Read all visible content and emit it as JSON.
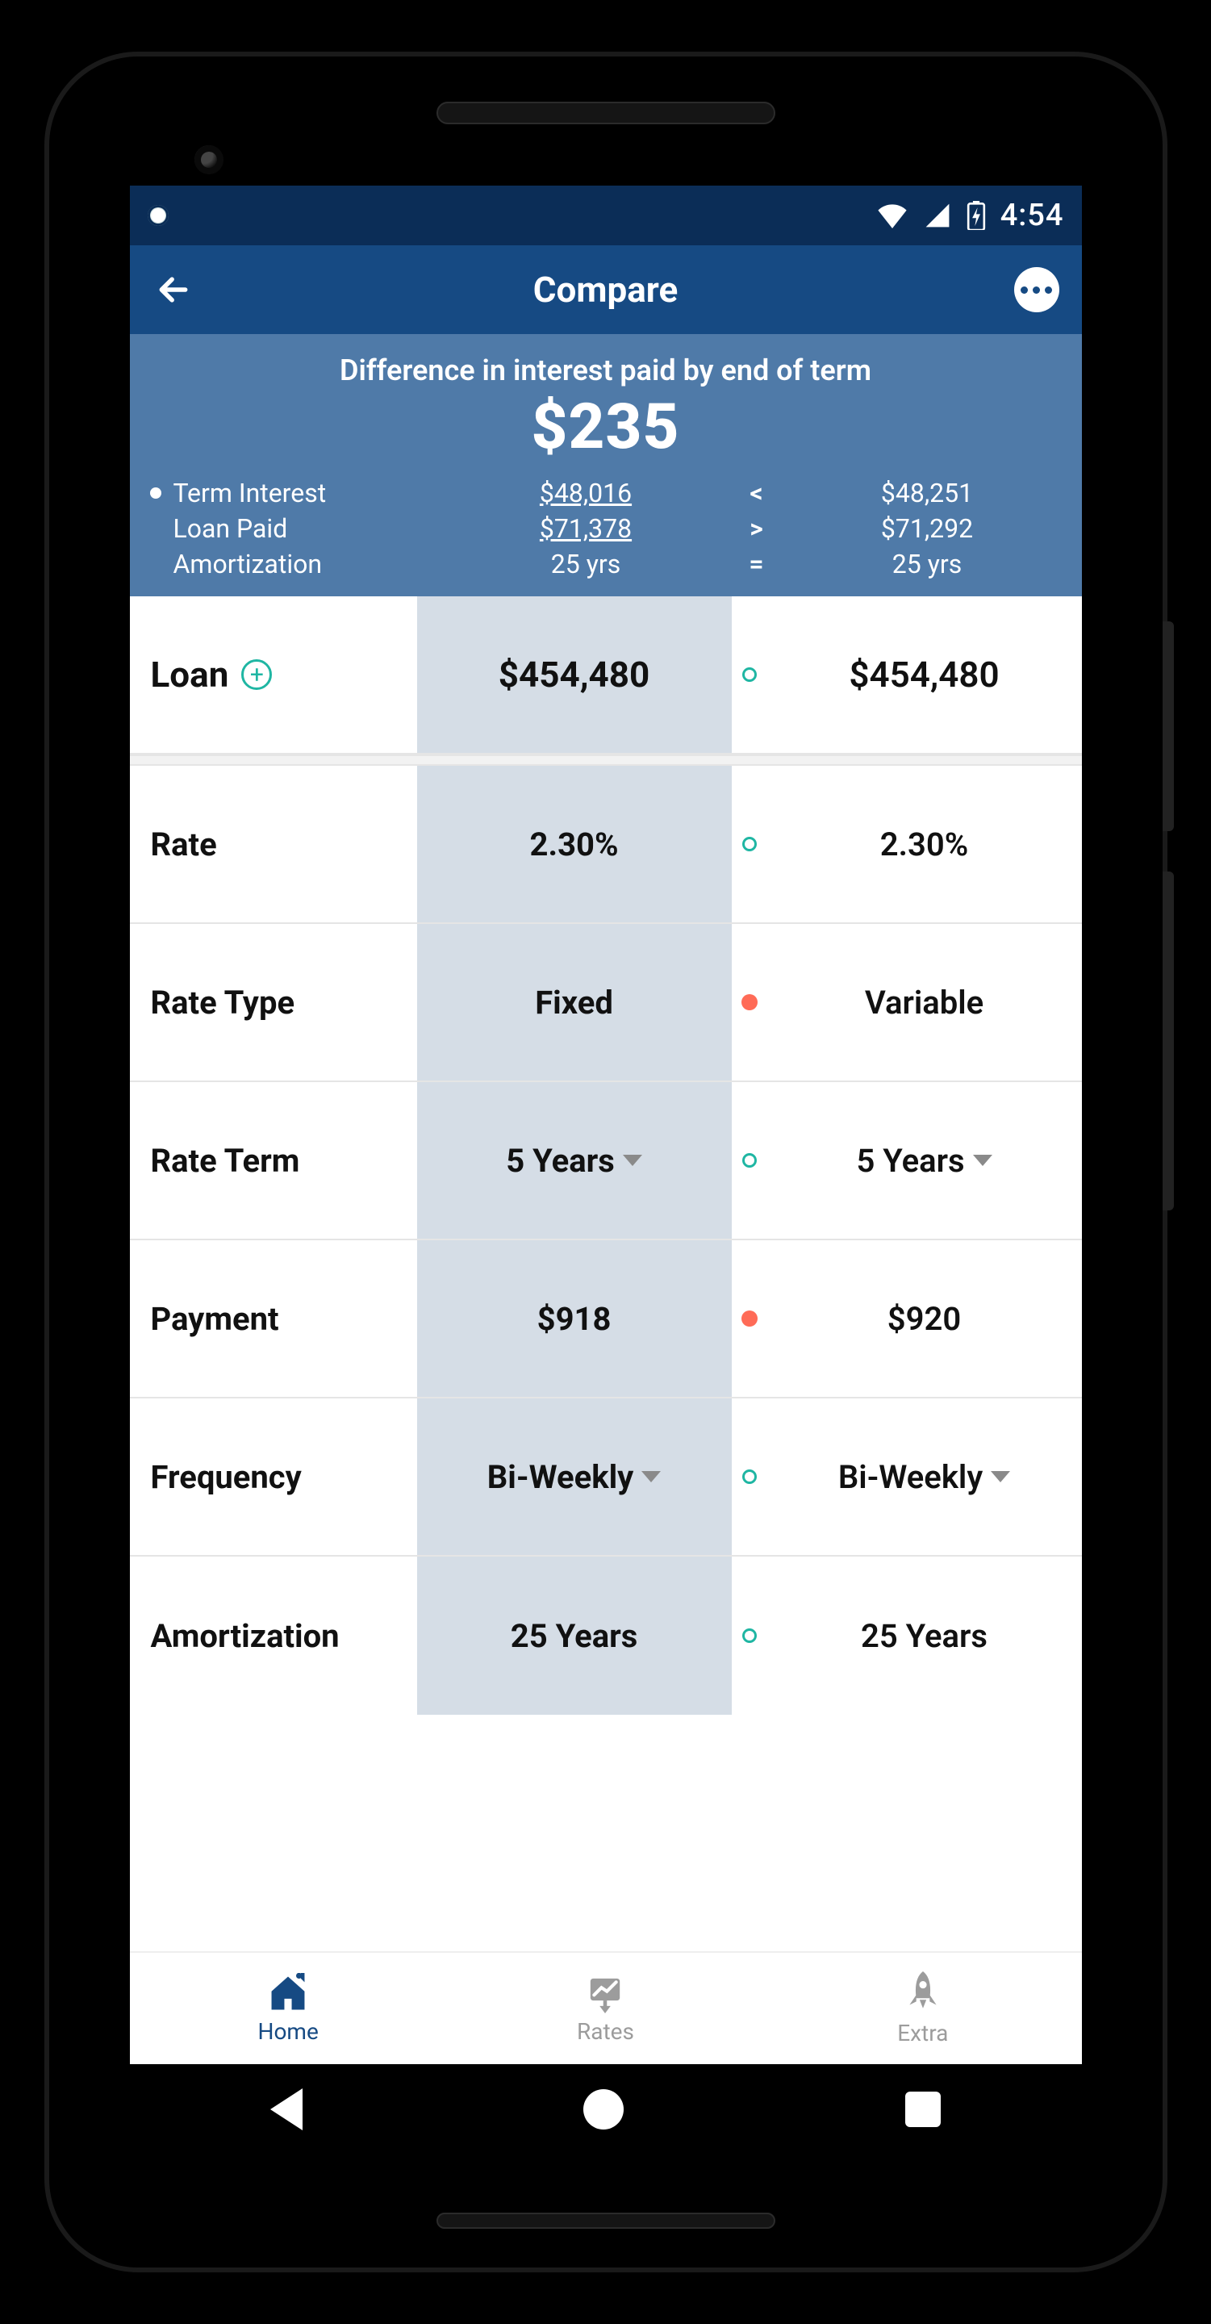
{
  "status": {
    "time": "4:54"
  },
  "appbar": {
    "title": "Compare"
  },
  "hero": {
    "headline": "Difference in interest paid by end of term",
    "amount": "$235",
    "rows": [
      {
        "label": "Term Interest",
        "a": "$48,016",
        "cmp": "<",
        "b": "$48,251",
        "bullet": true,
        "underline": true
      },
      {
        "label": "Loan Paid",
        "a": "$71,378",
        "cmp": ">",
        "b": "$71,292",
        "bullet": false,
        "underline": true
      },
      {
        "label": "Amortization",
        "a": "25 yrs",
        "cmp": "=",
        "b": "25 yrs",
        "bullet": false,
        "underline": false
      }
    ]
  },
  "rows": {
    "loan": {
      "label": "Loan",
      "a": "$454,480",
      "b": "$454,480",
      "diff": false
    },
    "rate": {
      "label": "Rate",
      "a": "2.30%",
      "b": "2.30%",
      "diff": false
    },
    "rateType": {
      "label": "Rate Type",
      "a": "Fixed",
      "b": "Variable",
      "diff": true
    },
    "rateTerm": {
      "label": "Rate Term",
      "a": "5 Years",
      "b": "5 Years",
      "diff": false
    },
    "payment": {
      "label": "Payment",
      "a": "$918",
      "b": "$920",
      "diff": true
    },
    "frequency": {
      "label": "Frequency",
      "a": "Bi-Weekly",
      "b": "Bi-Weekly",
      "diff": false
    },
    "amortization": {
      "label": "Amortization",
      "a": "25 Years",
      "b": "25 Years",
      "diff": false
    }
  },
  "tabs": {
    "home": "Home",
    "rates": "Rates",
    "extra": "Extra"
  }
}
